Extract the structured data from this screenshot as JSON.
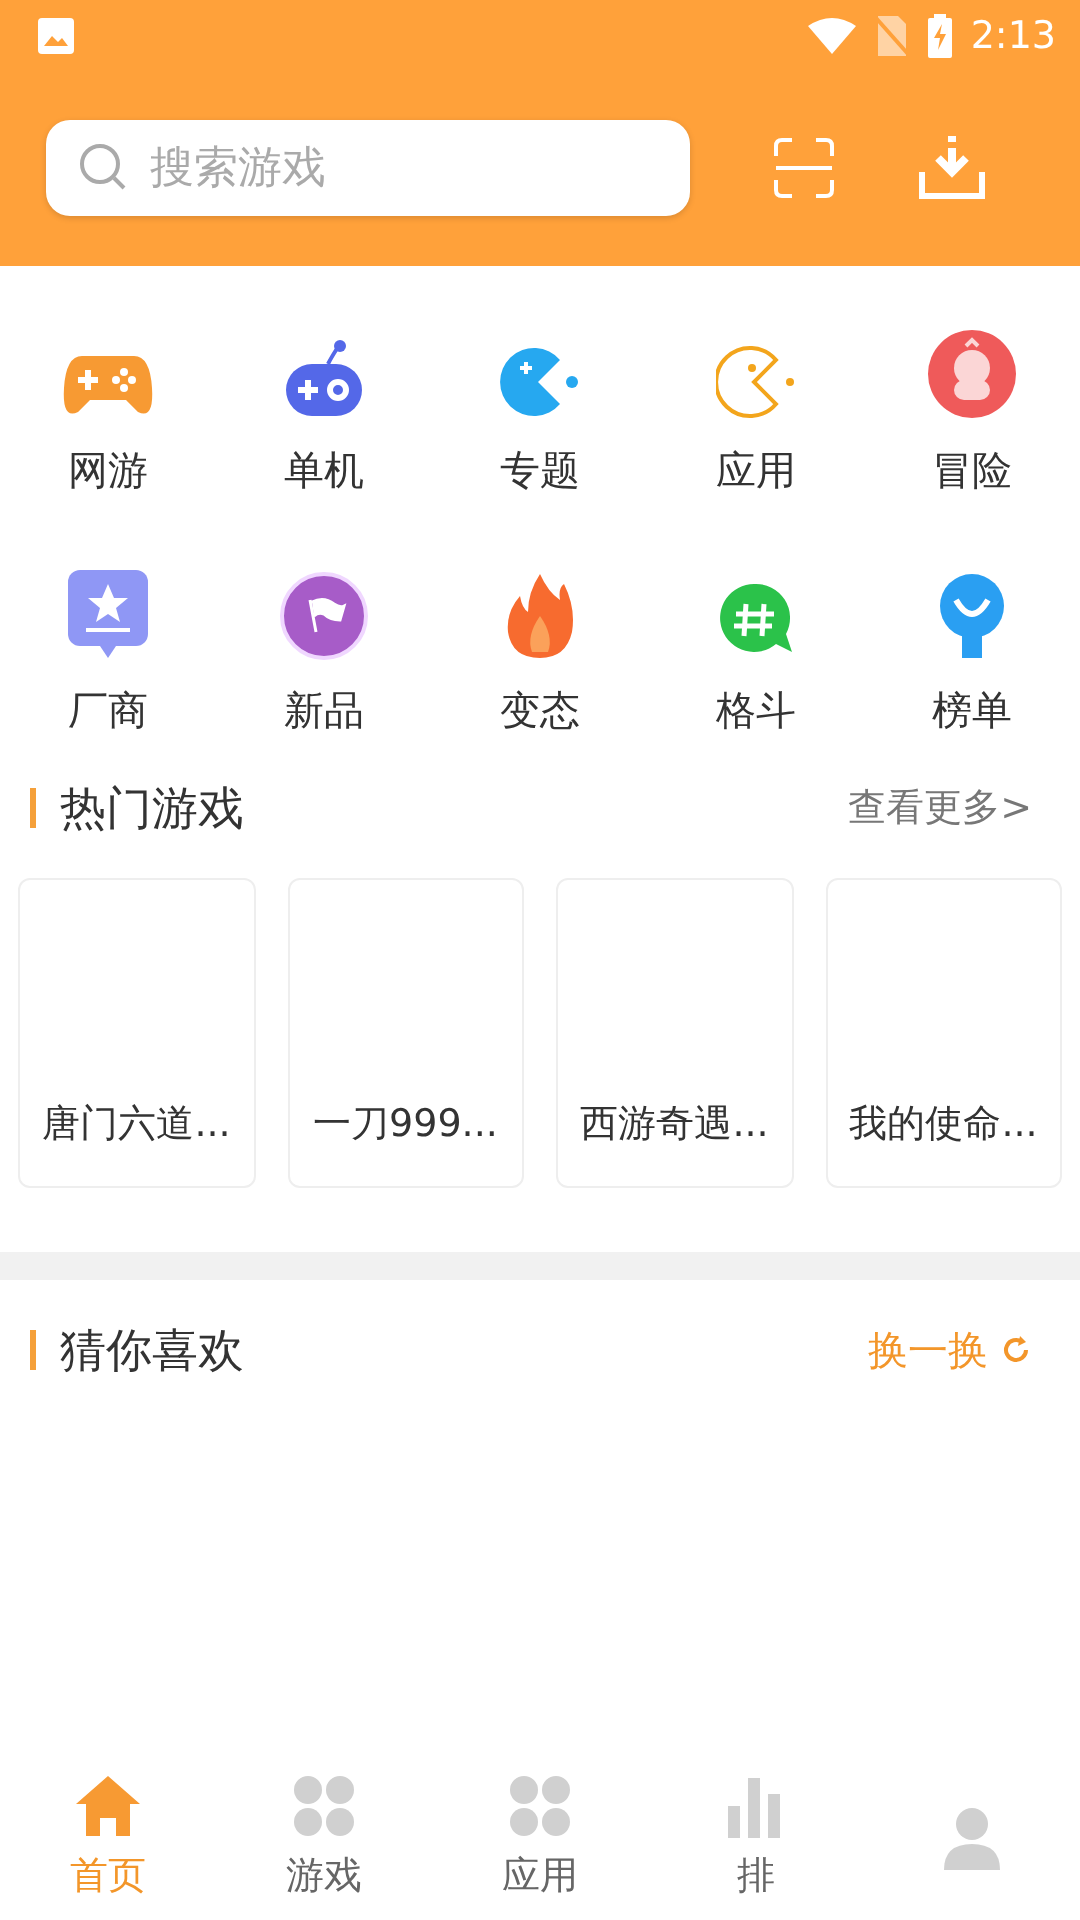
{
  "status_bar": {
    "time": "2:13"
  },
  "search": {
    "placeholder": "搜索游戏"
  },
  "categories": [
    {
      "label": "网游",
      "kind": "gamepad"
    },
    {
      "label": "单机",
      "kind": "joystick"
    },
    {
      "label": "专题",
      "kind": "pacman"
    },
    {
      "label": "应用",
      "kind": "pacman-outline"
    },
    {
      "label": "冒险",
      "kind": "mascot"
    },
    {
      "label": "厂商",
      "kind": "star-badge"
    },
    {
      "label": "新品",
      "kind": "flag"
    },
    {
      "label": "变态",
      "kind": "flame"
    },
    {
      "label": "格斗",
      "kind": "hash"
    },
    {
      "label": "榜单",
      "kind": "ranking"
    }
  ],
  "hot_games": {
    "title": "热门游戏",
    "more": "查看更多>",
    "games": [
      {
        "name": "唐门六道..."
      },
      {
        "name": "一刀999..."
      },
      {
        "name": "西游奇遇..."
      },
      {
        "name": "我的使命..."
      }
    ]
  },
  "recommend": {
    "title": "猜你喜欢",
    "refresh": "换一换"
  },
  "bottom_nav": [
    {
      "label": "首页",
      "kind": "home",
      "selected": true
    },
    {
      "label": "游戏",
      "kind": "grid",
      "selected": false
    },
    {
      "label": "应用",
      "kind": "grid",
      "selected": false
    },
    {
      "label": "排",
      "kind": "chart",
      "selected": false
    },
    {
      "kind": "person",
      "selected": false
    }
  ]
}
